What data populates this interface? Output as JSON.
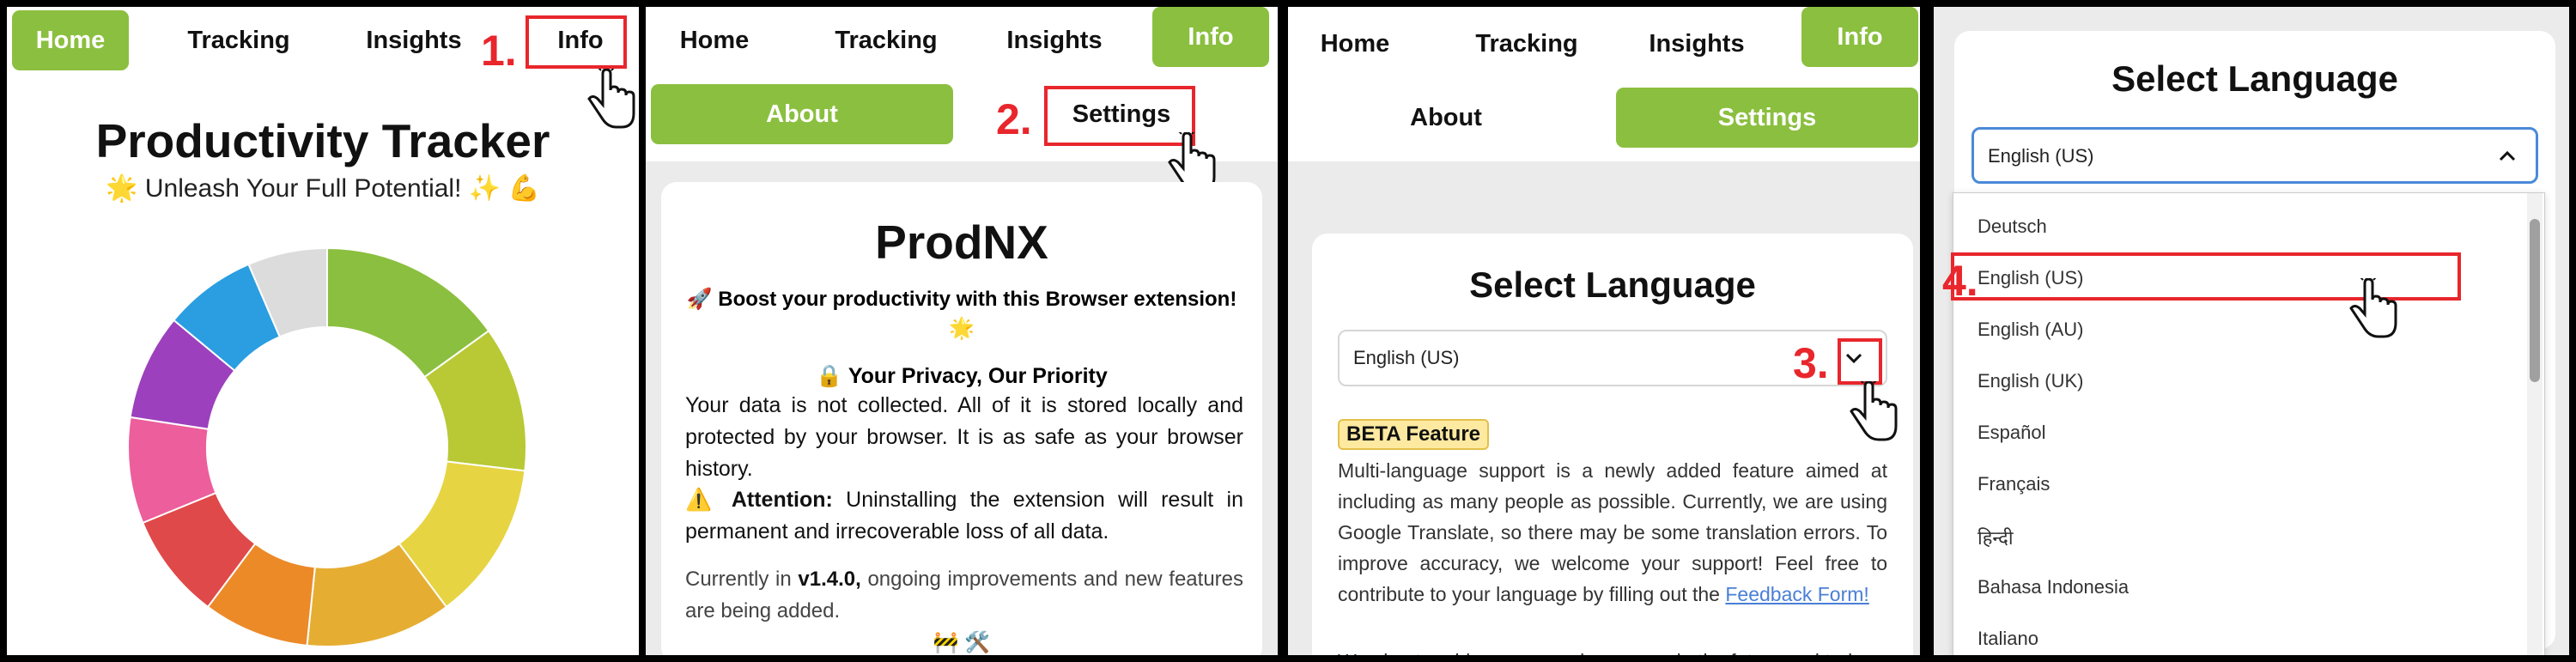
{
  "nav": {
    "home": "Home",
    "tracking": "Tracking",
    "insights": "Insights",
    "info": "Info"
  },
  "steps": {
    "s1": "1.",
    "s2": "2.",
    "s3": "3.",
    "s4": "4."
  },
  "panel1": {
    "title": "Productivity Tracker",
    "subtitle": "🌟 Unleash Your Full Potential! ✨ 💪",
    "donut_colors": [
      "#8bbf3f",
      "#b8c935",
      "#e6d443",
      "#e5ae33",
      "#ec8a28",
      "#e0494a",
      "#ec5e9c",
      "#9c40bd",
      "#2a9ee0",
      "#dcdcdc"
    ]
  },
  "panel2": {
    "about": "About",
    "settings": "Settings",
    "app_name": "ProdNX",
    "tagline": "🚀 Boost your productivity with this Browser extension! 🌟",
    "privacy_heading": "🔒 Your Privacy, Our Priority",
    "privacy_text": "Your data is not collected. All of it is stored locally and protected by your browser. It is as safe as your browser history.",
    "attention_label": "⚠️ Attention:",
    "attention_text": " Uninstalling the extension will result in permanent and irrecoverable loss of all data.",
    "version_prefix": "Currently in ",
    "version": "v1.4.0,",
    "version_suffix": " ongoing improvements and new features are being added.",
    "footer_icons": "🚧 🛠️"
  },
  "panel3": {
    "about": "About",
    "settings": "Settings",
    "select_title": "Select Language",
    "selected": "English (US)",
    "beta": "BETA Feature",
    "beta_text": "Multi-language support is a newly added feature aimed at including as many people as possible. Currently, we are using Google Translate, so there may be some translation errors. To improve accuracy, we welcome your support! Feel free to contribute to your language by filling out the ",
    "feedback_link": "Feedback Form!",
    "plan_text": "We plan to add many more languages in the future and truly"
  },
  "panel4": {
    "select_title": "Select Language",
    "selected": "English (US)",
    "options": [
      "Deutsch",
      "English (US)",
      "English (AU)",
      "English (UK)",
      "Español",
      "Français",
      "हिन्दी",
      "Bahasa Indonesia",
      "Italiano"
    ]
  },
  "colors": {
    "accent": "#8bbf3f",
    "highlight": "#e8262c",
    "link": "#4a7fd6"
  }
}
